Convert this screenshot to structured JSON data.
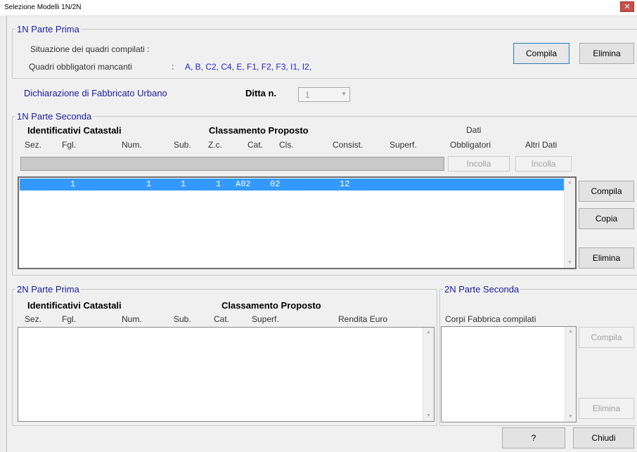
{
  "window": {
    "title": "Selezione Modelli 1N/2N",
    "close_glyph": "✕"
  },
  "parte_prima_1n": {
    "legend": "1N Parte Prima",
    "situazione_label": "Situazione dei quadri compilati :",
    "mancanti_label": "Quadri obbligatori mancanti",
    "mancanti_sep": ":",
    "mancanti_value": "A, B, C2, C4, E, F1, F2, F3, I1, I2,",
    "compila": "Compila",
    "elimina": "Elimina"
  },
  "dichiarazione": {
    "label": "Dichiarazione di Fabbricato Urbano",
    "ditta_label": "Ditta n.",
    "ditta_value": "1"
  },
  "parte_seconda_1n": {
    "legend": "1N Parte Seconda",
    "hdr_identificativi": "Identificativi Catastali",
    "hdr_classamento": "Classamento Proposto",
    "hdr_dati_1": "Dati",
    "hdr_dati_2": "Obbligatori",
    "hdr_altri": "Altri Dati",
    "cols": {
      "sez": "Sez.",
      "fgl": "Fgl.",
      "num": "Num.",
      "sub": "Sub.",
      "zc": "Z.c.",
      "cat": "Cat.",
      "cls": "Cls.",
      "consist": "Consist.",
      "superf": "Superf."
    },
    "incolla_1": "Incolla",
    "incolla_2": "Incolla",
    "row": {
      "fgl": "1",
      "num": "1",
      "sub": "1",
      "zc": "1",
      "cat": "A02",
      "cls": "02",
      "consist": "12"
    },
    "compila": "Compila",
    "copia": "Copia",
    "elimina": "Elimina"
  },
  "parte_prima_2n": {
    "legend": "2N Parte Prima",
    "hdr_identificativi": "Identificativi Catastali",
    "hdr_classamento": "Classamento Proposto",
    "cols": {
      "sez": "Sez.",
      "fgl": "Fgl.",
      "num": "Num.",
      "sub": "Sub.",
      "cat": "Cat.",
      "superf": "Superf.",
      "rendita": "Rendita Euro"
    }
  },
  "parte_seconda_2n": {
    "legend": "2N Parte Seconda",
    "corpi_label": "Corpi Fabbrica compilati",
    "compila": "Compila",
    "elimina": "Elimina"
  },
  "footer": {
    "help": "?",
    "chiudi": "Chiudi"
  },
  "colors": {
    "accent_blue": "#2222cc",
    "selection": "#3399ff",
    "close_red": "#c7504a"
  }
}
